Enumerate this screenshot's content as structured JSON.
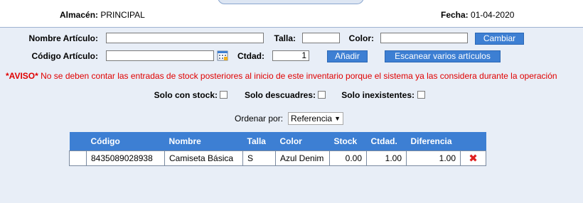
{
  "header": {
    "almacen_label": "Almacén:",
    "almacen_value": "PRINCIPAL",
    "fecha_label": "Fecha:",
    "fecha_value": "01-04-2020"
  },
  "form": {
    "nombre_label": "Nombre Artículo:",
    "nombre_value": "",
    "talla_label": "Talla:",
    "talla_value": "",
    "color_label": "Color:",
    "color_value": "",
    "cambiar_label": "Cambiar",
    "codigo_label": "Código Artículo:",
    "codigo_value": "",
    "ctdad_label": "Ctdad:",
    "ctdad_value": "1",
    "anadir_label": "Añadir",
    "escanear_label": "Escanear varios artículos"
  },
  "aviso": {
    "prefix": "*AVISO*",
    "text": " No se deben contar las entradas de stock posteriores al inicio de este inventario porque el sistema ya las considera durante la operación"
  },
  "filters": {
    "solo_stock": "Solo con stock:",
    "solo_descuadres": "Solo descuadres:",
    "solo_inexistentes": "Solo inexistentes:"
  },
  "order": {
    "label": "Ordenar por:",
    "selected": "Referencia"
  },
  "table": {
    "columns": [
      "",
      "Código",
      "Nombre",
      "Talla",
      "Color",
      "Stock",
      "Ctdad.",
      "Diferencia",
      ""
    ],
    "rows": [
      {
        "codigo": "8435089028938",
        "nombre": "Camiseta Básica",
        "talla": "S",
        "color": "Azul Denim",
        "stock": "0.00",
        "ctdad": "1.00",
        "diferencia": "1.00"
      }
    ]
  },
  "colors": {
    "accent": "#3d7fd3",
    "warning": "#e00000",
    "background": "#e8eef7"
  },
  "icons": {
    "calendar": "calendar-icon",
    "delete": "delete-icon"
  }
}
